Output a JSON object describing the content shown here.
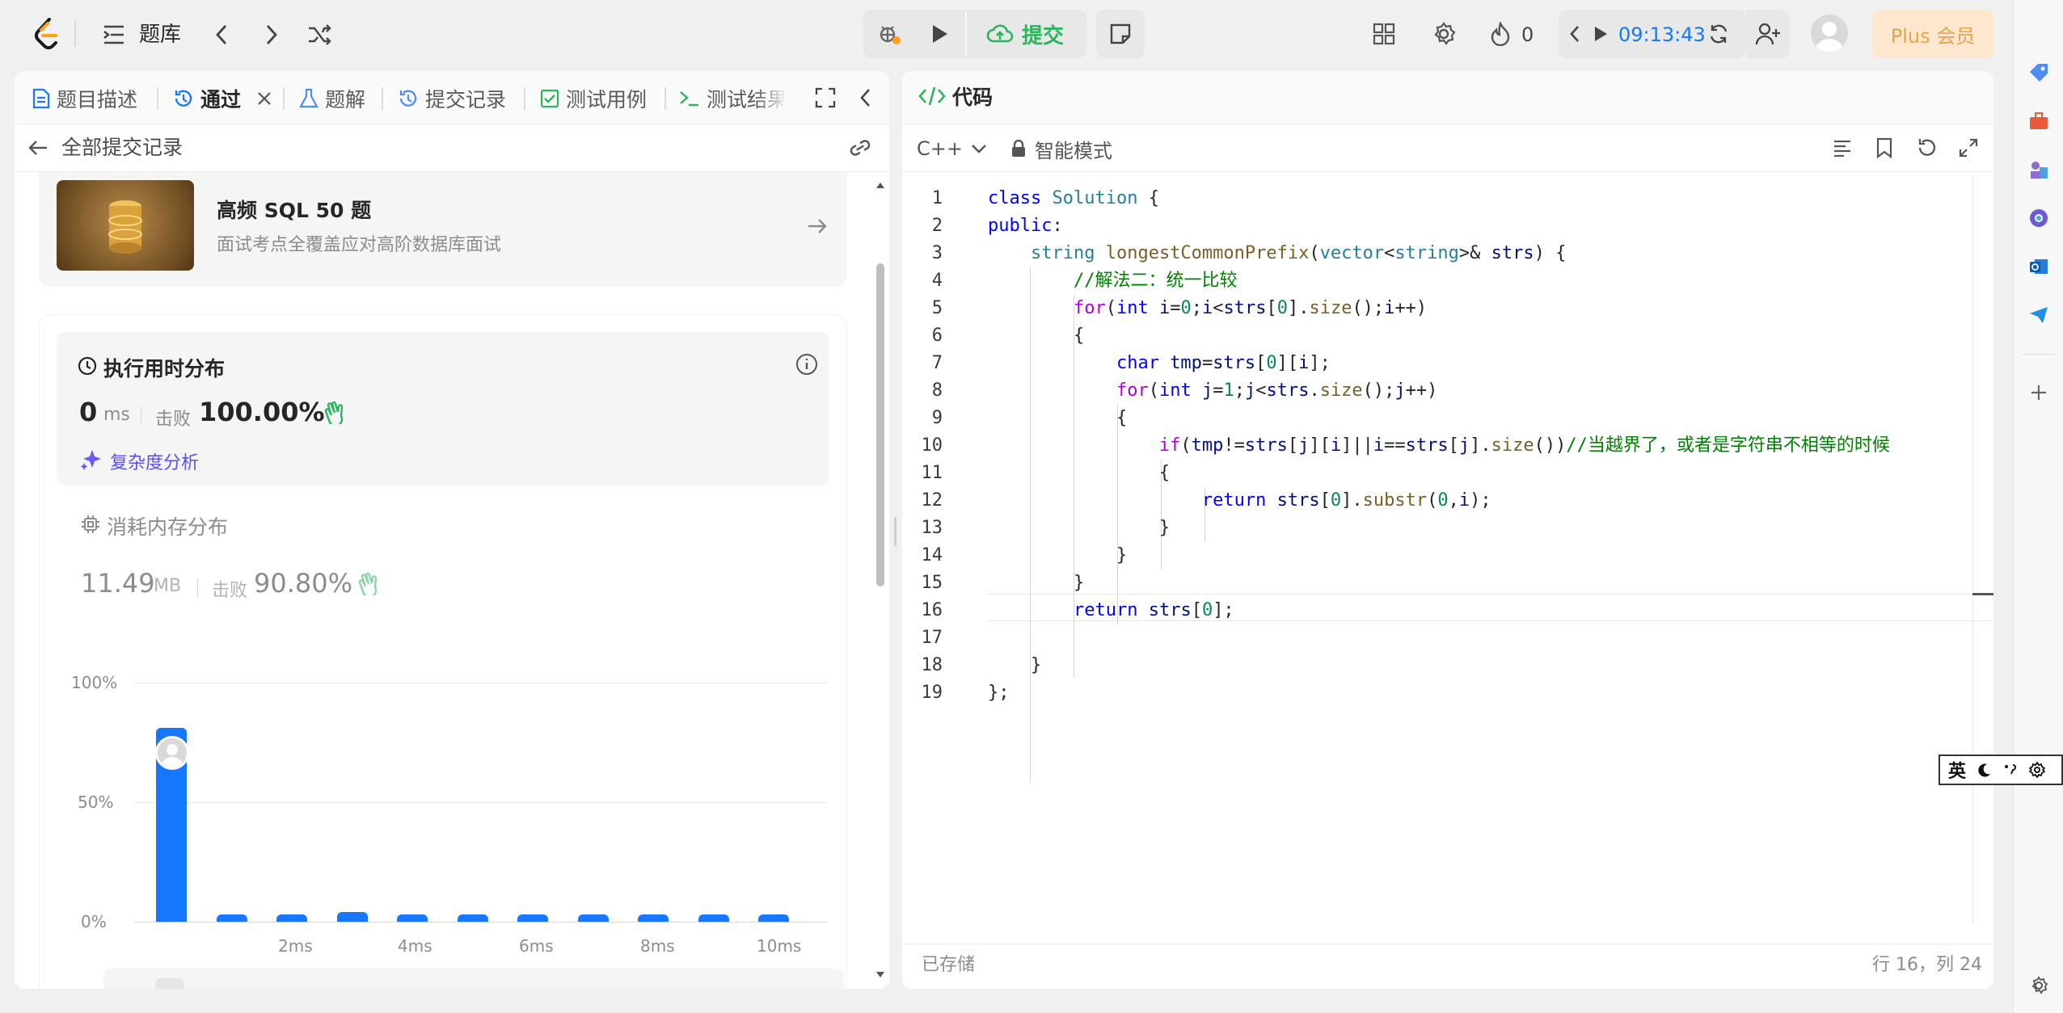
{
  "topbar": {
    "title": "题库",
    "submit_label": "提交",
    "streak_count": "0",
    "timer": "09:13:43",
    "plus_label": "Plus 会员"
  },
  "left_tabs": [
    {
      "label": "题目描述"
    },
    {
      "label": "通过"
    },
    {
      "label": "题解"
    },
    {
      "label": "提交记录"
    },
    {
      "label": "测试用例"
    },
    {
      "label": "测试结果"
    }
  ],
  "submissions_header": {
    "back_label": "全部提交记录"
  },
  "promo": {
    "title": "高频 SQL 50 题",
    "subtitle": "面试考点全覆盖应对高阶数据库面试"
  },
  "runtime": {
    "heading": "执行用时分布",
    "value": "0",
    "unit": "ms",
    "beat_label": "击败",
    "beat_value": "100.00%",
    "complexity_label": "复杂度分析"
  },
  "memory": {
    "heading": "消耗内存分布",
    "value": "11.49",
    "unit": "MB",
    "beat_label": "击败",
    "beat_value": "90.80%"
  },
  "chart_data": {
    "type": "bar",
    "categories": [
      "0ms",
      "1ms",
      "2ms",
      "3ms",
      "4ms",
      "5ms",
      "6ms",
      "7ms",
      "8ms",
      "9ms",
      "10ms"
    ],
    "values": [
      81,
      3,
      3,
      4,
      3,
      3,
      3,
      3,
      3,
      3,
      3
    ],
    "ylim": [
      0,
      100
    ],
    "y_ticks": [
      "100%",
      "50%",
      "0%"
    ],
    "x_ticks": [
      "2ms",
      "4ms",
      "6ms",
      "8ms",
      "10ms"
    ],
    "grid": true,
    "bar_color": "#1677ff"
  },
  "code_panel": {
    "title": "代码",
    "language": "C++",
    "mode_label": "智能模式",
    "status_saved": "已存储",
    "cursor_position": "行 16，列 24"
  },
  "code_lines": [
    "class Solution {",
    "public:",
    "    string longestCommonPrefix(vector<string>& strs) {",
    "        //解法二：统一比较",
    "        for(int i=0;i<strs[0].size();i++)",
    "        {",
    "            char tmp=strs[0][i];",
    "            for(int j=1;j<strs.size();j++)",
    "            {",
    "                if(tmp!=strs[j][i]||i==strs[j].size())//当越界了，或者是字符串不相等的时候",
    "                {",
    "                    return strs[0].substr(0,i);",
    "                }",
    "            }",
    "        }",
    "        return strs[0];",
    "",
    "    }",
    "};"
  ],
  "ime": {
    "lang": "英"
  },
  "colors": {
    "accent": "#1677ff",
    "success": "#2db55d",
    "timer": "#1677ff",
    "plus_bg": "#fde8cf",
    "plus_text": "#e8a34a"
  }
}
